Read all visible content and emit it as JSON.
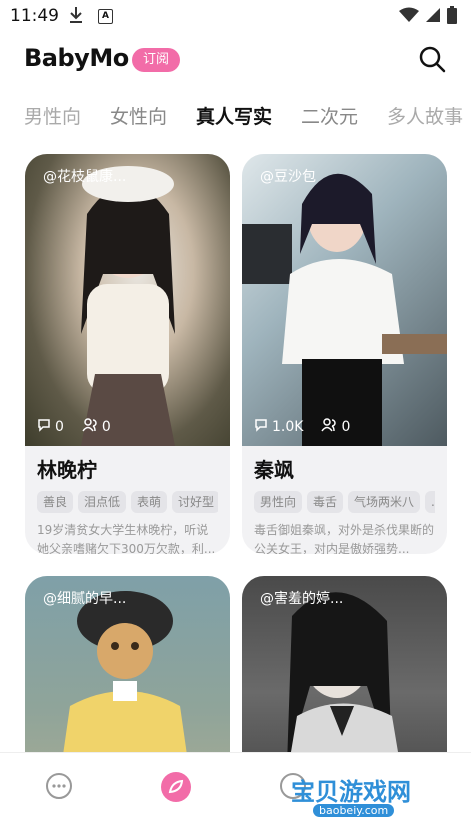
{
  "status": {
    "time": "11:49",
    "a_icon": "A"
  },
  "header": {
    "logo": "BabyMo",
    "subscribe": "订阅"
  },
  "tabs": [
    "男性向",
    "女性向",
    "真人写实",
    "二次元",
    "多人故事"
  ],
  "cards": [
    {
      "author": "@花枝鼠康...",
      "comments": "0",
      "users": "0",
      "name": "林晚柠",
      "tags": [
        "善良",
        "泪点低",
        "表萌",
        "讨好型"
      ],
      "desc": "19岁清贫女大学生林晚柠，听说她父亲嗜赌欠下300万欠款，利..."
    },
    {
      "author": "@豆沙包",
      "comments": "1.0K",
      "users": "0",
      "name": "秦飒",
      "tags": [
        "男性向",
        "毒舌",
        "气场两米八",
        "..."
      ],
      "desc": "毒舌御姐秦飒，对外是杀伐果断的公关女王，对内是傲娇强势..."
    },
    {
      "author": "@细腻的早..."
    },
    {
      "author": "@害羞的婷..."
    }
  ],
  "watermark": {
    "text": "宝贝游戏网",
    "url": "baobeiy.com"
  },
  "colors": {
    "accent": "#f26ca8",
    "tag_bg": "#e4e4e8"
  }
}
